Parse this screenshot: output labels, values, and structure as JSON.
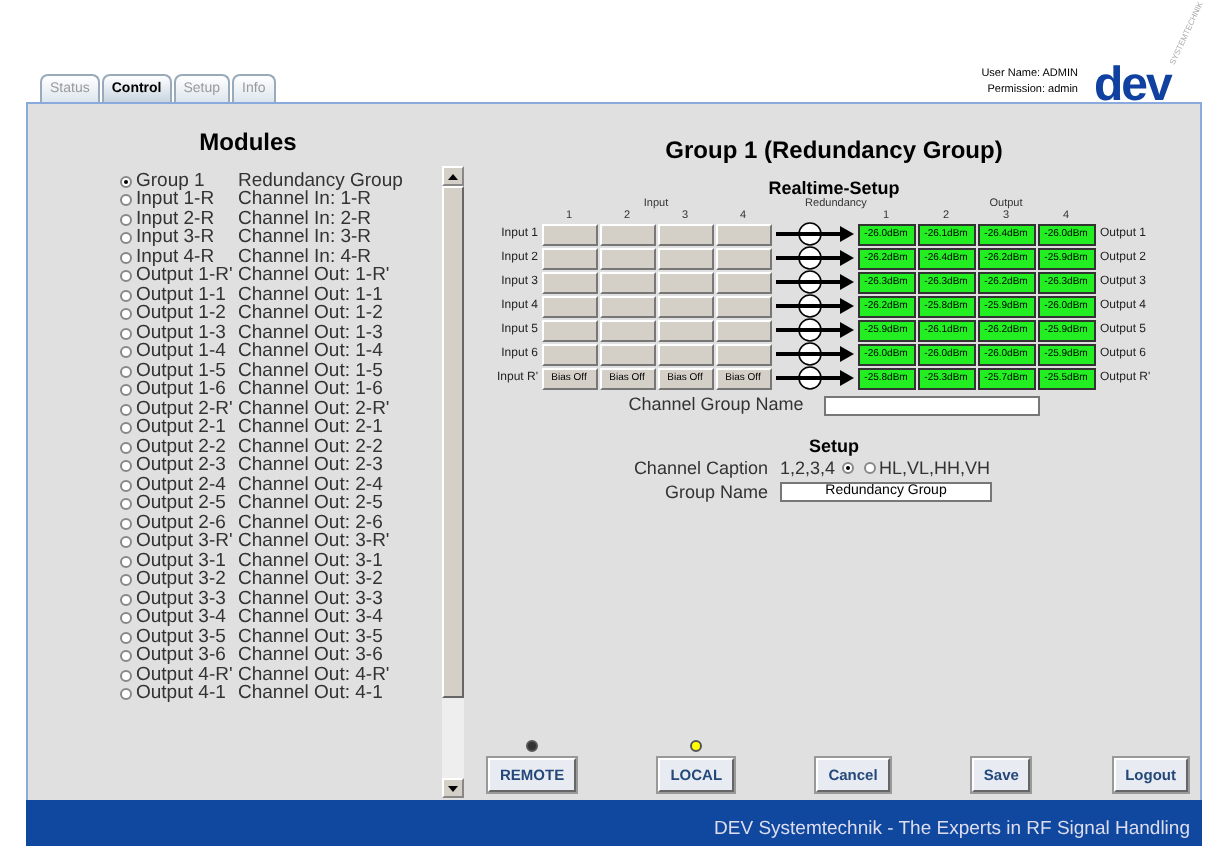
{
  "tabs": [
    {
      "label": "Status",
      "selected": false
    },
    {
      "label": "Control",
      "selected": true
    },
    {
      "label": "Setup",
      "selected": false
    },
    {
      "label": "Info",
      "selected": false
    }
  ],
  "user": {
    "user_name": "User Name: ADMIN",
    "permission": "Permission: admin"
  },
  "logo": {
    "text": "dev",
    "tagline": "SYSTEMTECHNIK"
  },
  "modules": {
    "title": "Modules",
    "items": [
      {
        "name": "Group 1",
        "description": "Redundancy Group",
        "selected": true
      },
      {
        "name": "Input 1-R",
        "description": "Channel In: 1-R",
        "selected": false
      },
      {
        "name": "Input 2-R",
        "description": "Channel In: 2-R",
        "selected": false
      },
      {
        "name": "Input 3-R",
        "description": "Channel In: 3-R",
        "selected": false
      },
      {
        "name": "Input 4-R",
        "description": "Channel In: 4-R",
        "selected": false
      },
      {
        "name": "Output 1-R'",
        "description": "Channel Out: 1-R'",
        "selected": false
      },
      {
        "name": "Output 1-1",
        "description": "Channel Out: 1-1",
        "selected": false
      },
      {
        "name": "Output 1-2",
        "description": "Channel Out: 1-2",
        "selected": false
      },
      {
        "name": "Output 1-3",
        "description": "Channel Out: 1-3",
        "selected": false
      },
      {
        "name": "Output 1-4",
        "description": "Channel Out: 1-4",
        "selected": false
      },
      {
        "name": "Output 1-5",
        "description": "Channel Out: 1-5",
        "selected": false
      },
      {
        "name": "Output 1-6",
        "description": "Channel Out: 1-6",
        "selected": false
      },
      {
        "name": "Output 2-R'",
        "description": "Channel Out: 2-R'",
        "selected": false
      },
      {
        "name": "Output 2-1",
        "description": "Channel Out: 2-1",
        "selected": false
      },
      {
        "name": "Output 2-2",
        "description": "Channel Out: 2-2",
        "selected": false
      },
      {
        "name": "Output 2-3",
        "description": "Channel Out: 2-3",
        "selected": false
      },
      {
        "name": "Output 2-4",
        "description": "Channel Out: 2-4",
        "selected": false
      },
      {
        "name": "Output 2-5",
        "description": "Channel Out: 2-5",
        "selected": false
      },
      {
        "name": "Output 2-6",
        "description": "Channel Out: 2-6",
        "selected": false
      },
      {
        "name": "Output 3-R'",
        "description": "Channel Out: 3-R'",
        "selected": false
      },
      {
        "name": "Output 3-1",
        "description": "Channel Out: 3-1",
        "selected": false
      },
      {
        "name": "Output 3-2",
        "description": "Channel Out: 3-2",
        "selected": false
      },
      {
        "name": "Output 3-3",
        "description": "Channel Out: 3-3",
        "selected": false
      },
      {
        "name": "Output 3-4",
        "description": "Channel Out: 3-4",
        "selected": false
      },
      {
        "name": "Output 3-5",
        "description": "Channel Out: 3-5",
        "selected": false
      },
      {
        "name": "Output 3-6",
        "description": "Channel Out: 3-6",
        "selected": false
      },
      {
        "name": "Output 4-R'",
        "description": "Channel Out: 4-R'",
        "selected": false
      },
      {
        "name": "Output 4-1",
        "description": "Channel Out: 4-1",
        "selected": false
      }
    ]
  },
  "group_title": "Group 1 (Redundancy Group)",
  "realtime": {
    "title": "Realtime-Setup",
    "input_header": "Input",
    "redundancy_header": "Redundancy",
    "output_header": "Output",
    "input_columns": [
      "1",
      "2",
      "3",
      "4"
    ],
    "output_columns": [
      "1",
      "2",
      "3",
      "4"
    ],
    "rows": [
      {
        "input_label": "Input 1",
        "outputs": [
          "-26.0dBm",
          "-26.1dBm",
          "-26.4dBm",
          "-26.0dBm"
        ],
        "output_label": "Output 1"
      },
      {
        "input_label": "Input 2",
        "outputs": [
          "-26.2dBm",
          "-26.4dBm",
          "-26.2dBm",
          "-25.9dBm"
        ],
        "output_label": "Output 2"
      },
      {
        "input_label": "Input 3",
        "outputs": [
          "-26.3dBm",
          "-26.3dBm",
          "-26.2dBm",
          "-26.3dBm"
        ],
        "output_label": "Output 3"
      },
      {
        "input_label": "Input 4",
        "outputs": [
          "-26.2dBm",
          "-25.8dBm",
          "-25.9dBm",
          "-26.0dBm"
        ],
        "output_label": "Output 4"
      },
      {
        "input_label": "Input 5",
        "outputs": [
          "-25.9dBm",
          "-26.1dBm",
          "-26.2dBm",
          "-25.9dBm"
        ],
        "output_label": "Output 5"
      },
      {
        "input_label": "Input 6",
        "outputs": [
          "-26.0dBm",
          "-26.0dBm",
          "-26.0dBm",
          "-25.9dBm"
        ],
        "output_label": "Output 6"
      },
      {
        "input_label": "Input R'",
        "inputs": [
          "Bias Off",
          "Bias Off",
          "Bias Off",
          "Bias Off"
        ],
        "outputs": [
          "-25.8dBm",
          "-25.3dBm",
          "-25.7dBm",
          "-25.5dBm"
        ],
        "output_label": "Output R'"
      }
    ]
  },
  "channel_group_name": {
    "label": "Channel Group Name"
  },
  "setup": {
    "title": "Setup",
    "caption_label": "Channel Caption",
    "caption_options": [
      {
        "label": "1,2,3,4",
        "kind": "before",
        "selected": true
      },
      {
        "label": "HL,VL,HH,VH",
        "kind": "after",
        "selected": false
      }
    ],
    "group_name_label": "Group Name",
    "group_name_value": "Redundancy Group"
  },
  "buttons": [
    {
      "label": "REMOTE",
      "color": "#333333"
    },
    {
      "label": "LOCAL",
      "color": "#ffff00"
    },
    {
      "label": "Cancel"
    },
    {
      "label": "Save"
    },
    {
      "label": "Logout"
    }
  ],
  "footer": "DEV Systemtechnik - The Experts in RF Signal Handling"
}
